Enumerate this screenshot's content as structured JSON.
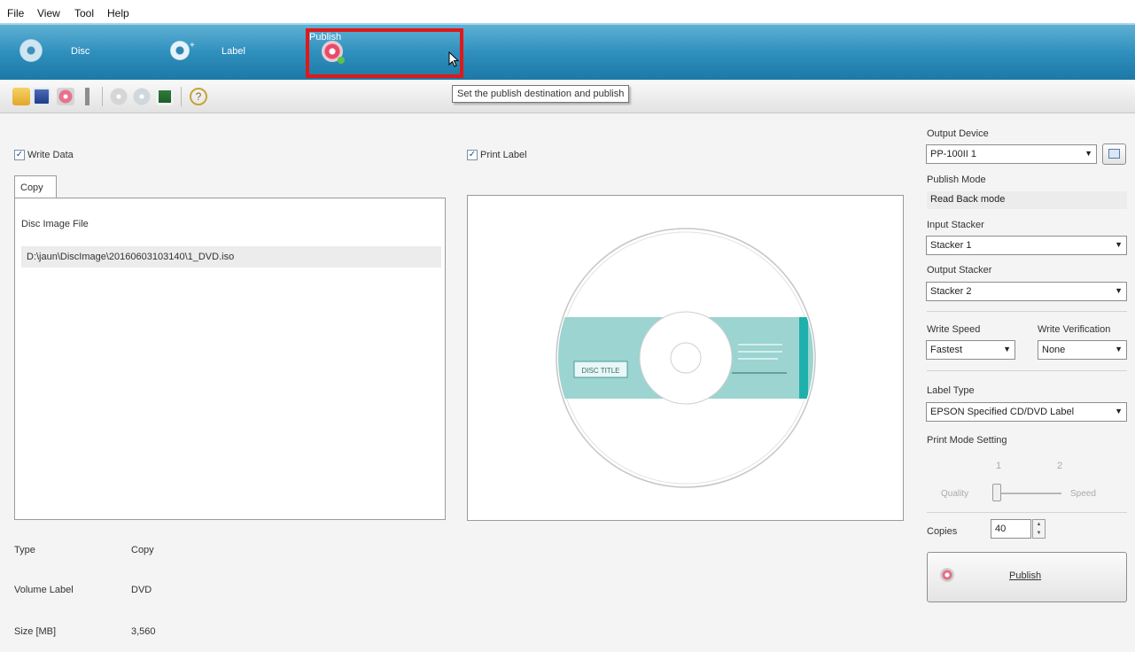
{
  "menu": [
    "File",
    "View",
    "Tool",
    "Help"
  ],
  "ribbon": {
    "tabs": [
      {
        "label": "Disc",
        "icon": "disc-icon"
      },
      {
        "label": "Label",
        "icon": "label-disc-icon"
      },
      {
        "label": "Publish",
        "icon": "publish-disc-icon"
      }
    ],
    "active_tab": "Publish",
    "highlight_color": "#e01818"
  },
  "toolbar": {
    "icons": [
      "open-icon",
      "save-icon",
      "publish-icon",
      "settings-icon",
      "disc-copy-icon",
      "disc-print-icon",
      "export-icon",
      "help-icon"
    ]
  },
  "tooltip": "Set the publish destination and publish",
  "write_data": {
    "label": "Write Data",
    "checked": true
  },
  "print_label": {
    "label": "Print Label",
    "checked": true
  },
  "copy_tab": {
    "label": "Copy"
  },
  "disc_image": {
    "label": "Disc Image File",
    "path": "D:\\jaun\\DiscImage\\20160603103140\\1_DVD.iso"
  },
  "disc_label_preview": {
    "title": "DISC TITLE",
    "band_color": "#9bd4d0",
    "accent_color": "#1fb0ad"
  },
  "info": [
    {
      "key": "Type",
      "value": "Copy"
    },
    {
      "key": "Volume Label",
      "value": "DVD"
    },
    {
      "key": "Size [MB]",
      "value": "3,560"
    }
  ],
  "right_panel": {
    "output_device": {
      "label": "Output Device",
      "value": "PP-100II 1"
    },
    "publish_mode": {
      "label": "Publish Mode",
      "value": "Read Back mode"
    },
    "input_stacker": {
      "label": "Input Stacker",
      "value": "Stacker 1"
    },
    "output_stacker": {
      "label": "Output Stacker",
      "value": "Stacker 2"
    },
    "write_speed": {
      "label": "Write Speed",
      "value": "Fastest"
    },
    "write_verification": {
      "label": "Write Verification",
      "value": "None"
    },
    "label_type": {
      "label": "Label Type",
      "value": "EPSON Specified CD/DVD Label"
    },
    "print_mode": {
      "label": "Print Mode Setting",
      "tick1": "1",
      "tick2": "2",
      "left": "Quality",
      "right": "Speed",
      "level_fraction": 0.0
    },
    "copies": {
      "label": "Copies",
      "value": "40"
    },
    "publish_button": "Publish"
  }
}
